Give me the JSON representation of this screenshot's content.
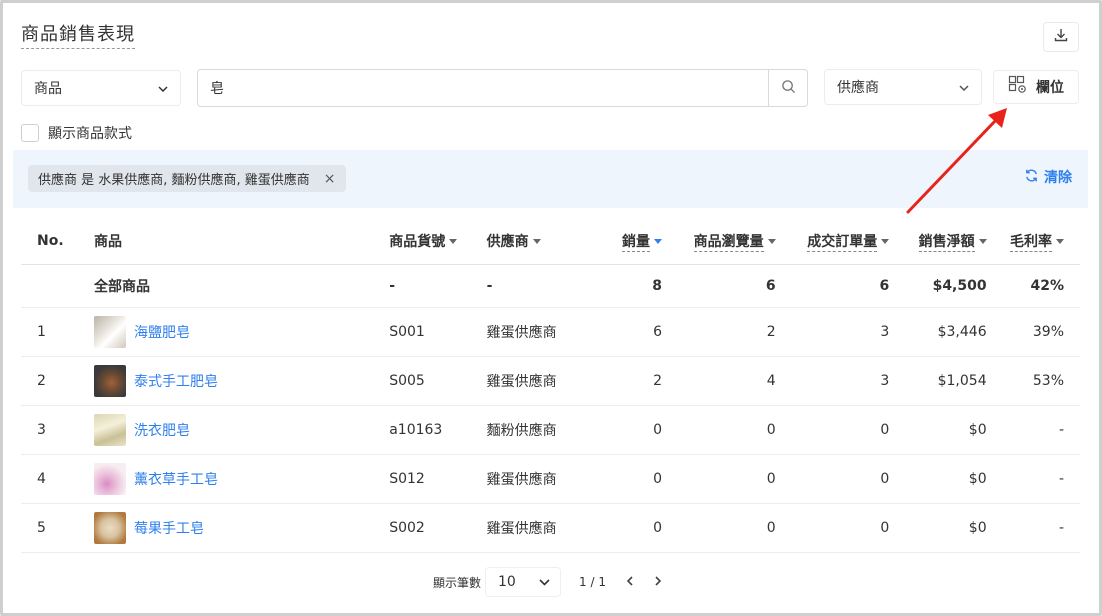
{
  "page_title": "商品銷售表現",
  "filters": {
    "category_select": "商品",
    "search_value": "皂",
    "supplier_select": "供應商",
    "columns_button": "欄位",
    "show_variants_label": "顯示商品款式"
  },
  "active_filter": {
    "chip_text": "供應商 是 水果供應商, 麵粉供應商, 雞蛋供應商",
    "chip_close": "×",
    "clear_label": "清除"
  },
  "table": {
    "headers": {
      "no": "No.",
      "product": "商品",
      "sku": "商品貨號",
      "supplier": "供應商",
      "sales_qty": "銷量",
      "views": "商品瀏覽量",
      "orders": "成交訂單量",
      "net_sales": "銷售淨額",
      "margin": "毛利率"
    },
    "total_row": {
      "label": "全部商品",
      "sku": "-",
      "supplier": "-",
      "sales_qty": "8",
      "views": "6",
      "orders": "6",
      "net_sales": "$4,500",
      "margin": "42%"
    },
    "rows": [
      {
        "no": "1",
        "name": "海鹽肥皂",
        "sku": "S001",
        "supplier": "雞蛋供應商",
        "sales_qty": "6",
        "views": "2",
        "orders": "3",
        "net_sales": "$3,446",
        "margin": "39%"
      },
      {
        "no": "2",
        "name": "泰式手工肥皂",
        "sku": "S005",
        "supplier": "雞蛋供應商",
        "sales_qty": "2",
        "views": "4",
        "orders": "3",
        "net_sales": "$1,054",
        "margin": "53%"
      },
      {
        "no": "3",
        "name": "洗衣肥皂",
        "sku": "a10163",
        "supplier": "麵粉供應商",
        "sales_qty": "0",
        "views": "0",
        "orders": "0",
        "net_sales": "$0",
        "margin": "-"
      },
      {
        "no": "4",
        "name": "薰衣草手工皂",
        "sku": "S012",
        "supplier": "雞蛋供應商",
        "sales_qty": "0",
        "views": "0",
        "orders": "0",
        "net_sales": "$0",
        "margin": "-"
      },
      {
        "no": "5",
        "name": "莓果手工皂",
        "sku": "S002",
        "supplier": "雞蛋供應商",
        "sales_qty": "0",
        "views": "0",
        "orders": "0",
        "net_sales": "$0",
        "margin": "-"
      }
    ]
  },
  "pagination": {
    "per_page_label": "顯示筆數",
    "per_page_value": "10",
    "page_indicator": "1 / 1"
  },
  "colors": {
    "accent": "#2f80ed",
    "filter_bg": "#eff5fd",
    "annotation_arrow": "#e8231b"
  },
  "icons": [
    "download-icon",
    "chevron-down-icon",
    "search-icon",
    "column-settings-icon",
    "refresh-icon",
    "close-icon",
    "chevron-left-icon",
    "chevron-right-icon",
    "sort-caret-icon"
  ]
}
